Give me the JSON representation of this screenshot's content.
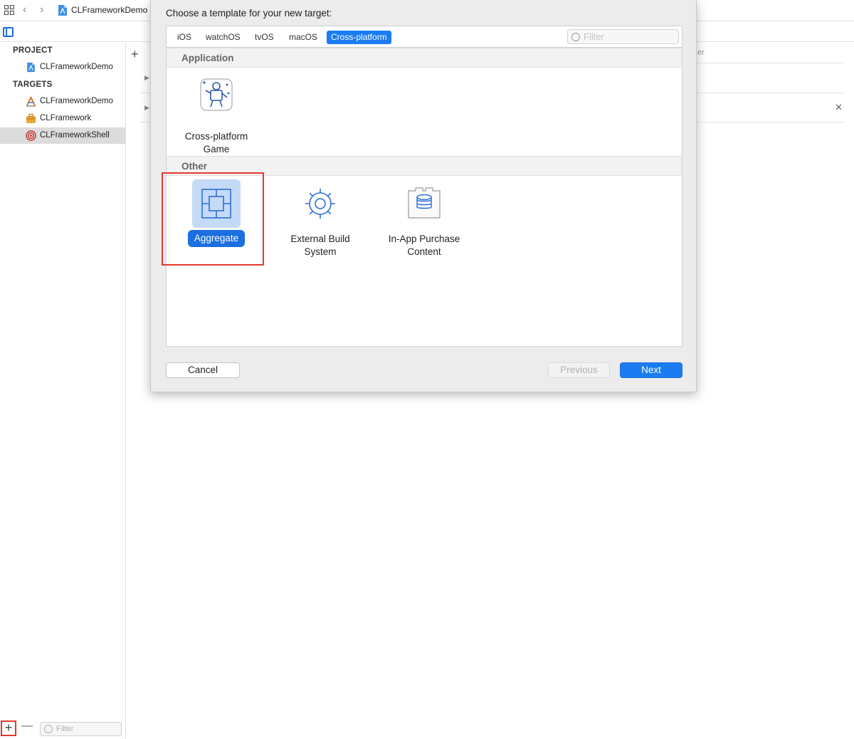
{
  "toolbar": {
    "breadcrumb": "CLFrameworkDemo"
  },
  "sidebar": {
    "project_header": "PROJECT",
    "project_item": "CLFrameworkDemo",
    "targets_header": "TARGETS",
    "targets": [
      {
        "label": "CLFrameworkDemo",
        "icon": "app-target-icon"
      },
      {
        "label": "CLFramework",
        "icon": "framework-toolbox-icon"
      },
      {
        "label": "CLFrameworkShell",
        "icon": "aggregate-target-icon",
        "selected": true
      }
    ],
    "filter_placeholder": "Filter"
  },
  "sheet": {
    "title": "Choose a template for your new target:",
    "platform_tabs": [
      "iOS",
      "watchOS",
      "tvOS",
      "macOS",
      "Cross-platform"
    ],
    "active_tab": "Cross-platform",
    "filter_placeholder": "Filter",
    "groups": [
      {
        "name": "Application",
        "templates": [
          {
            "label": "Cross-platform Game",
            "line1": "Cross-platform",
            "line2": "Game",
            "icon": "game-robot-icon"
          }
        ]
      },
      {
        "name": "Other",
        "templates": [
          {
            "label": "Aggregate",
            "icon": "aggregate-icon",
            "selected": true
          },
          {
            "label": "External Build System",
            "line1": "External Build",
            "line2": "System",
            "icon": "gear-icon"
          },
          {
            "label": "In-App Purchase Content",
            "line1": "In-App Purchase",
            "line2": "Content",
            "icon": "coin-stack-icon"
          }
        ]
      }
    ],
    "buttons": {
      "cancel": "Cancel",
      "previous": "Previous",
      "next": "Next"
    }
  },
  "editor": {
    "partial_text": "er"
  },
  "colors": {
    "accent": "#1b7cf2",
    "selection_bg": "#c5daf6",
    "highlight_red": "#e5392b"
  }
}
